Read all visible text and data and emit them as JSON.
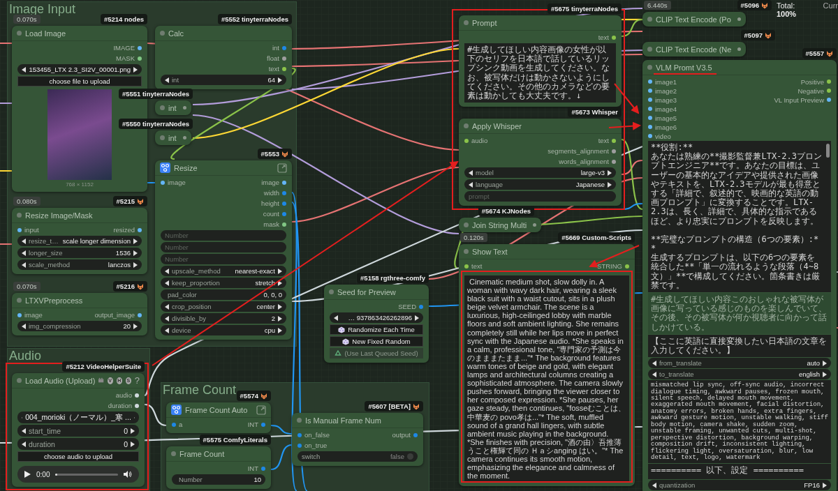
{
  "groups": [
    {
      "title": "Image Input"
    },
    {
      "title": "Audio"
    },
    {
      "title": "Frame Count"
    }
  ],
  "stats": {
    "total_label": "Total:",
    "total_value": "100%",
    "current": "Curr"
  },
  "nodes": [
    {
      "badge": "#5214 nodes",
      "badge_logo": false,
      "timing": "0.070s",
      "title": "Load Image",
      "collapsed": false,
      "outputs": [
        {
          "label": "IMAGE",
          "color": "#64b5f6"
        },
        {
          "label": "MASK",
          "color": "#81c784"
        }
      ],
      "widgets": [
        {
          "kind": "combo",
          "value": "153455_LTX 2.3_SI2V_00001.png"
        },
        {
          "kind": "button",
          "label": "choose file to upload",
          "disabled": false
        },
        {
          "kind": "preview",
          "caption": "768 × 1152"
        }
      ]
    },
    {
      "badge": "#5552 tinyterraNodes",
      "badge_logo": false,
      "title": "Calc",
      "collapsed": false,
      "outputs": [
        {
          "label": "int",
          "color": "#1e88e5"
        },
        {
          "label": "float",
          "color": "#9e9e9e"
        },
        {
          "label": "text",
          "color": "#8bc34a"
        }
      ],
      "widgets": [
        {
          "kind": "combo",
          "label": "int",
          "value": "64"
        }
      ]
    },
    {
      "badge": "#5551 tinyterraNodes",
      "badge_logo": false,
      "title": "int",
      "collapsed": true
    },
    {
      "badge": "#5550 tinyterraNodes",
      "badge_logo": false,
      "title": "int",
      "collapsed": true
    },
    {
      "badge": "#5553",
      "badge_logo": true,
      "title": "Resize",
      "collapsed": false,
      "inputs": [
        {
          "label": "image",
          "color": "#64b5f6"
        }
      ],
      "outputs": [
        {
          "label": "image",
          "color": "#64b5f6"
        },
        {
          "label": "width",
          "color": "#1e88e5"
        },
        {
          "label": "height",
          "color": "#1e88e5"
        },
        {
          "label": "count",
          "color": "#1e88e5"
        },
        {
          "label": "mask",
          "color": "#81c784"
        }
      ],
      "widgets": [
        {
          "kind": "placeholder",
          "placeholder": "Number"
        },
        {
          "kind": "placeholder",
          "placeholder": "Number"
        },
        {
          "kind": "placeholder",
          "placeholder": "Number"
        },
        {
          "kind": "combo",
          "label": "upscale_method",
          "value": "nearest-exact"
        },
        {
          "kind": "combo",
          "label": "keep_proportion",
          "value": "stretch"
        },
        {
          "kind": "field",
          "label": "pad_color",
          "value": "0, 0, 0"
        },
        {
          "kind": "combo",
          "label": "crop_position",
          "value": "center"
        },
        {
          "kind": "combo",
          "label": "divisible_by",
          "value": "2"
        },
        {
          "kind": "combo",
          "label": "device",
          "value": "cpu"
        }
      ]
    },
    {
      "badge": "#5215",
      "badge_logo": true,
      "timing": "0.080s",
      "title": "Resize Image/Mask",
      "collapsed": false,
      "inputs": [
        {
          "label": "input",
          "color": "#64b5f6"
        }
      ],
      "outputs": [
        {
          "label": "resized",
          "color": "#64b5f6"
        }
      ],
      "widgets": [
        {
          "kind": "combo",
          "label": "resize_t…",
          "value": "scale longer dimension"
        },
        {
          "kind": "combo",
          "label": "longer_size",
          "value": "1536"
        },
        {
          "kind": "combo",
          "label": "scale_method",
          "value": "lanczos"
        }
      ]
    },
    {
      "badge": "#5216",
      "badge_logo": true,
      "timing": "0.070s",
      "title": "LTXVPreprocess",
      "collapsed": false,
      "inputs": [
        {
          "label": "image",
          "color": "#64b5f6"
        }
      ],
      "outputs": [
        {
          "label": "output_image",
          "color": "#64b5f6"
        }
      ],
      "widgets": [
        {
          "kind": "combo",
          "label": "img_compression",
          "value": "20"
        }
      ]
    },
    {
      "badge": "#5212 VideoHelperSuite",
      "badge_logo": false,
      "title": "Load Audio (Upload)",
      "tags": [
        "V",
        "H",
        "S"
      ],
      "help": "?",
      "collapsed": false,
      "outputs": [
        {
          "label": "audio",
          "color": "#cfd8dc"
        },
        {
          "label": "duration",
          "color": "#cfd8dc"
        }
      ],
      "widgets": [
        {
          "kind": "combo",
          "value": "004_morioki（ノーマル）_寒 ..."
        },
        {
          "kind": "combo",
          "label": "start_time",
          "value": "0"
        },
        {
          "kind": "combo",
          "label": "duration",
          "value": "0"
        },
        {
          "kind": "button",
          "label": "choose audio to upload",
          "disabled": false
        },
        {
          "kind": "audio",
          "time": "0:00",
          "level": 0
        }
      ]
    },
    {
      "badge": "#5574",
      "badge_logo": true,
      "title": "Frame Count Auto",
      "collapsed": false,
      "inputs": [
        {
          "label": "a",
          "color": "#1e88e5"
        }
      ],
      "outputs": [
        {
          "label": "INT",
          "color": "#1e88e5"
        }
      ]
    },
    {
      "badge": "#5575 ComfyLiterals",
      "badge_logo": false,
      "title": "Frame Count",
      "collapsed": false,
      "outputs": [
        {
          "label": "INT",
          "color": "#1e88e5"
        }
      ],
      "widgets": [
        {
          "kind": "number",
          "label": "Number",
          "value": "10"
        }
      ]
    },
    {
      "badge": "#5158 rgthree-comfy",
      "badge_logo": false,
      "title": "Seed for Preview",
      "collapsed": false,
      "outputs": [
        {
          "label": "SEED",
          "color": "#1e88e5"
        }
      ],
      "widgets": [
        {
          "kind": "combo",
          "value": "… 937863426262896"
        },
        {
          "kind": "button",
          "label": "Randomize Each Time",
          "disabled": false
        },
        {
          "kind": "button",
          "label": "New Fixed Random",
          "disabled": false
        },
        {
          "kind": "button",
          "label": "(Use Last Queued Seed)",
          "disabled": true
        }
      ]
    },
    {
      "badge": "#5607 [BETA]",
      "badge_logo": true,
      "title": "Is Manual Frame Num",
      "collapsed": false,
      "inputs": [
        {
          "label": "on_false",
          "color": "#1e88e5"
        },
        {
          "label": "on_true",
          "color": "#1e88e5"
        }
      ],
      "outputs": [
        {
          "label": "output",
          "color": "#1e88e5"
        }
      ],
      "widgets": [
        {
          "kind": "toggle",
          "label": "switch",
          "value": "false",
          "on": false
        }
      ]
    },
    {
      "badge": "#5675 tinyterraNodes",
      "badge_logo": false,
      "title": "Prompt",
      "collapsed": false,
      "outputs": [
        {
          "label": "text",
          "color": "#8bc34a"
        }
      ],
      "widgets": [
        {
          "kind": "textarea",
          "disabled": false,
          "scroll": false,
          "value": "#生成してほしい内容画像の女性が以下のセリフを日本語で話しているリップシンク動画を生成してください。なお、被写体だけは動かさないようにしてください。その他のカメラなどの要素は動かしても大丈夫です。↓"
        }
      ]
    },
    {
      "badge": "#5673 Whisper",
      "badge_logo": false,
      "title": "Apply Whisper",
      "collapsed": false,
      "inputs": [
        {
          "label": "audio",
          "color": "#8bc34a"
        }
      ],
      "outputs": [
        {
          "label": "text",
          "color": "#8bc34a"
        },
        {
          "label": "segments_alignment",
          "color": "#9e9e9e"
        },
        {
          "label": "words_alignment",
          "color": "#9e9e9e"
        }
      ],
      "widgets": [
        {
          "kind": "combo",
          "label": "model",
          "value": "large-v3"
        },
        {
          "kind": "combo",
          "label": "language",
          "value": "Japanese"
        },
        {
          "kind": "placeholder",
          "placeholder": "prompt"
        }
      ]
    },
    {
      "badge": "#5674 KJNodes",
      "badge_logo": false,
      "title": "Join String Multi",
      "collapsed": true
    },
    {
      "badge": "#5669 Custom-Scripts",
      "badge_logo": false,
      "timing": "0.120s",
      "title": "Show Text",
      "collapsed": false,
      "inputs": [
        {
          "label": "text",
          "color": "#8bc34a"
        }
      ],
      "outputs": [
        {
          "label": "STRING",
          "color": "#8bc34a"
        }
      ],
      "widgets": [
        {
          "kind": "textarea",
          "disabled": false,
          "scroll": false,
          "value": " Cinematic medium shot, slow dolly in. A woman with wavy dark hair, wearing a sleek black suit with a waist cutout, sits in a plush beige velvet armchair. The scene is a luxurious, high-ceilinged lobby with marble floors and soft ambient lighting. She remains completely still while her lips move in perfect sync with the Japanese audio. *She speaks in a calm, professional tone, \"専門家の予測は今のまままたまま...\"* The background features warm tones of beige and gold, with elegant lamps and architectural columns creating a sophisticated atmosphere. The camera slowly pushes forward, bringing the viewer closer to her composed expression. *She pauses, her gaze steady, then continues, \"fosseむことは、中華麦の povo孝は...\"* The soft, muffled sound of a grand hall lingers, with subtle ambient music playing in the background. *She finishes with precision, \"酒の由〉吾推薄うこと権輝て同の Ｈａシanging はい。\"* The camera continues its smooth motion, emphasizing the elegance and calmness of the moment."
        }
      ]
    },
    {
      "badge": "#5096",
      "badge_logo": true,
      "timing": "6.440s",
      "title": "CLIP Text Encode (Po",
      "collapsed": true
    },
    {
      "badge": "#5097",
      "badge_logo": true,
      "title": "CLIP Text Encode (Ne",
      "collapsed": true
    },
    {
      "badge": "#5557",
      "badge_logo": true,
      "title": "VLM Promt V3.5",
      "collapsed": false,
      "inputs": [
        {
          "label": "image1",
          "color": "#64b5f6"
        },
        {
          "label": "image2",
          "color": "#64b5f6"
        },
        {
          "label": "image3",
          "color": "#64b5f6"
        },
        {
          "label": "image4",
          "color": "#64b5f6"
        },
        {
          "label": "image5",
          "color": "#64b5f6"
        },
        {
          "label": "image6",
          "color": "#64b5f6"
        },
        {
          "label": "video",
          "color": "#64b5f6"
        }
      ],
      "outputs": [
        {
          "label": "Positive",
          "color": "#8bc34a"
        },
        {
          "label": "Negative",
          "color": "#8bc34a"
        },
        {
          "label": "VL Input Preview",
          "color": "#64b5f6"
        }
      ],
      "widgets": [
        {
          "kind": "textarea",
          "disabled": false,
          "scroll": true,
          "value": "**役割:**\nあなたは熟練の**撮影監督兼LTX-2.3プロンプトエンジニア**です。あなたの目標は、ユーザーの基本的なアイデアや提供された画像やテキストを、LTX-2.3モデルが最も得意とする「詳細で、叙述的で、映画的な英語の動画プロンプト」に変換することです。LTX-2.3は、長く、詳細で、具体的な指示であるほど、より忠実にプロンプトを反映します。\n\n**完璧なプロンプトの構造（6つの要素）:**\n生成するプロンプトは、以下の6つの要素を統合した**「単一の流れるような段落（4~8文）」**で構成してください。箇条書きは厳禁です。"
        },
        {
          "kind": "textarea",
          "disabled": true,
          "scroll": false,
          "value": "#生成してほしい内容このおしゃれな被写体が画像に写っている感じのものを楽しんでいて、その後、その被写体が何か視聴者に向かって話しかけている。"
        },
        {
          "kind": "textarea",
          "disabled": false,
          "scroll": false,
          "value": "【ここに英語に直接変換したい日本語の文章を入力してください。】"
        },
        {
          "kind": "combo",
          "label": "from_translate",
          "value": "auto"
        },
        {
          "kind": "combo",
          "label": "to_translate",
          "value": "english"
        },
        {
          "kind": "textarea",
          "disabled": false,
          "scroll": false,
          "value": "mismatched lip sync, off-sync audio, incorrect dialogue timing, awkward pauses, frozen mouth, silent speech, delayed mouth movement, exaggerated mouth movement, facial distortion, anatomy errors, broken hands, extra fingers, awkward gesture motion, unstable walking, stiff body motion, camera shake, sudden zoom, unstable framing, unwanted cuts, multi-shot, perspective distortion, background warping, composition drift, inconsistent lighting, flickering light, oversaturation, blur, low detail, text, logo, watermark"
        },
        {
          "kind": "textarea",
          "disabled": false,
          "scroll": false,
          "value": "========== 以下、設定 =========="
        },
        {
          "kind": "combo",
          "label": "quantization",
          "value": "FP16"
        }
      ]
    }
  ]
}
